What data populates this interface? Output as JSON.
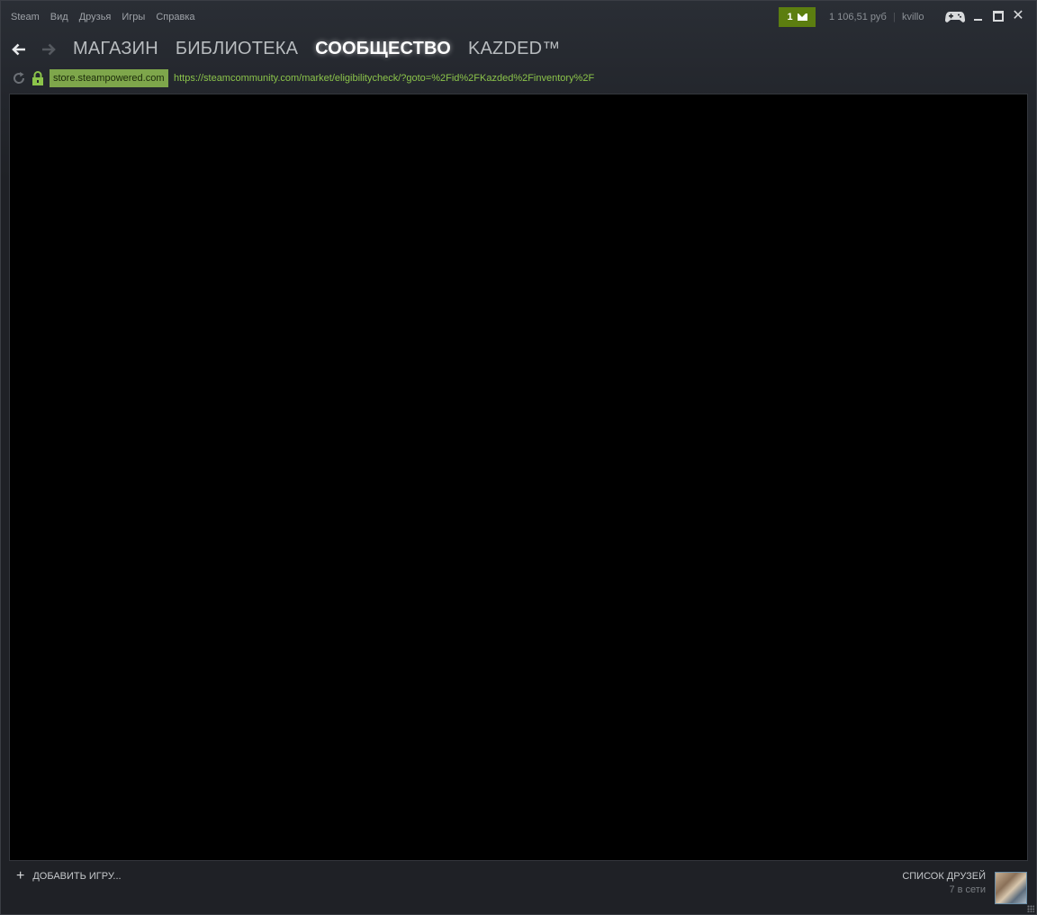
{
  "menu": {
    "items": [
      "Steam",
      "Вид",
      "Друзья",
      "Игры",
      "Справка"
    ]
  },
  "notifications": {
    "count": "1",
    "icon": "envelope-icon",
    "color": "#5c7e10"
  },
  "account": {
    "wallet": "1 106,51 руб",
    "separator": "|",
    "username": "kvillo"
  },
  "window_controls": {
    "big_picture_icon": "gamepad-icon",
    "minimize_icon": "minimize-icon",
    "maximize_icon": "maximize-icon",
    "close_icon": "close-icon",
    "close_glyph": "✕"
  },
  "nav": {
    "back_icon": "arrow-left-icon",
    "forward_icon": "arrow-right-icon",
    "tabs": [
      {
        "label": "МАГАЗИН",
        "active": false
      },
      {
        "label": "БИБЛИОТЕКА",
        "active": false
      },
      {
        "label": "СООБЩЕСТВО",
        "active": true
      },
      {
        "label": "KAZDED™",
        "active": false
      }
    ]
  },
  "address": {
    "reload_icon": "reload-icon",
    "lock_icon": "lock-icon",
    "domain": "store.steampowered.com",
    "url": "https://steamcommunity.com/market/eligibilitycheck/?goto=%2Fid%2FKazded%2Finventory%2F",
    "domain_color": "#7ea64b",
    "url_color": "#8bc34a"
  },
  "footer": {
    "add_game_icon": "plus-icon",
    "add_game_label": "ДОБАВИТЬ ИГРУ...",
    "friends_title": "СПИСОК ДРУЗЕЙ",
    "friends_online": "7 в сети"
  }
}
